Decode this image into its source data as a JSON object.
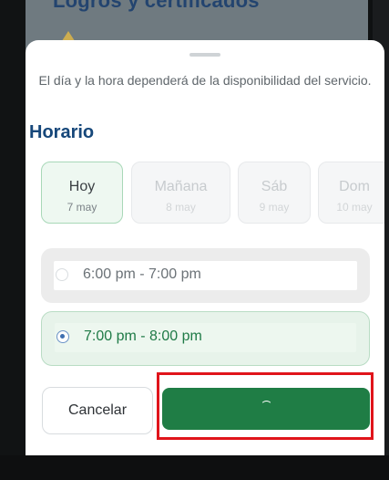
{
  "background": {
    "title": "Logros y certificados",
    "icon": "warning-triangle-icon"
  },
  "sheet": {
    "subtitle": "El día y la hora dependerá de la disponibilidad del servicio.",
    "section_title": "Horario",
    "dates": [
      {
        "day": "Hoy",
        "date": "7 may",
        "selected": true
      },
      {
        "day": "Mañana",
        "date": "8 may",
        "selected": false
      },
      {
        "day": "Sáb",
        "date": "9 may",
        "selected": false
      },
      {
        "day": "Dom",
        "date": "10 may",
        "selected": false
      }
    ],
    "slots": [
      {
        "label": "6:00 pm - 7:00 pm",
        "selected": false
      },
      {
        "label": "7:00 pm - 8:00 pm",
        "selected": true
      }
    ],
    "cancel_label": "Cancelar",
    "confirm_state": "loading",
    "confirm_icon": "spinner-icon"
  },
  "colors": {
    "accent_green": "#1f7d45",
    "title_blue": "#16477a",
    "highlight_red": "#e0141b"
  }
}
